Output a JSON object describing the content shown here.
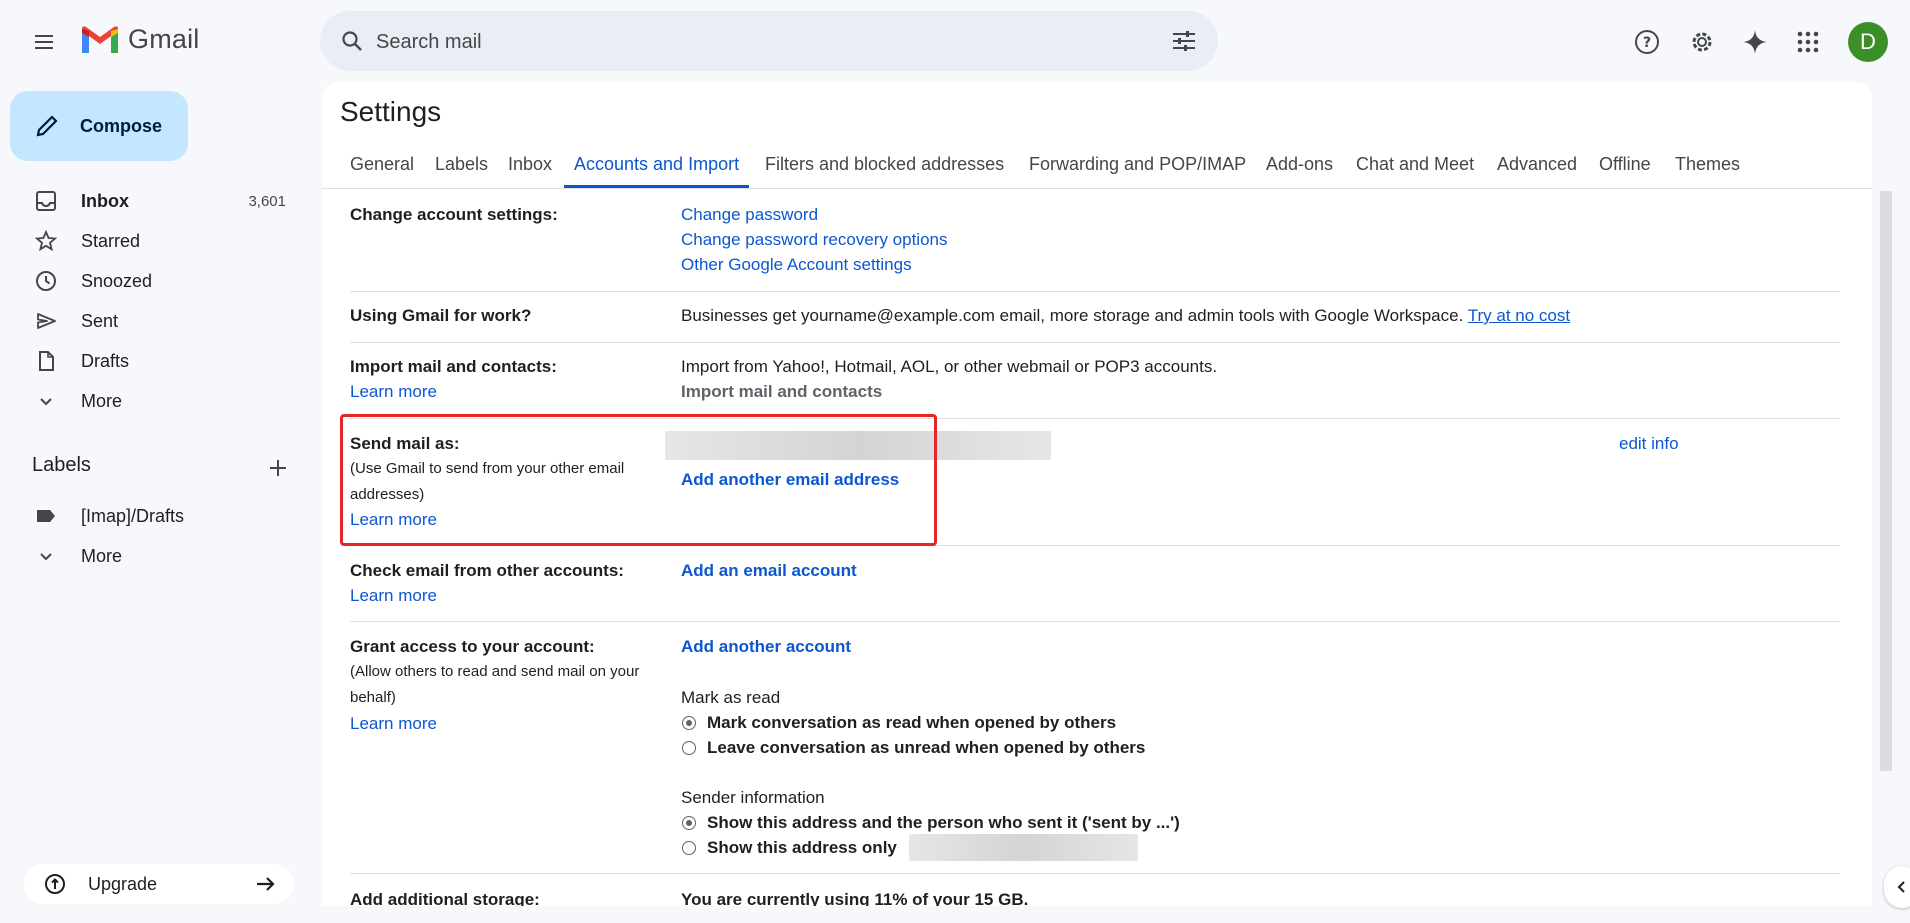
{
  "app": {
    "name": "Gmail",
    "colors": {
      "accent": "#0b57d0",
      "compose_bg": "#c2e7ff",
      "avatar_bg": "#3c8e28",
      "highlight": "#e32626"
    }
  },
  "search": {
    "placeholder": "Search mail"
  },
  "header": {
    "avatar_letter": "D",
    "icons": [
      "help-icon",
      "gear-icon",
      "gemini-sparkle-icon",
      "apps-grid-icon"
    ]
  },
  "sidebar": {
    "compose_label": "Compose",
    "items": [
      {
        "label": "Inbox",
        "count": "3,601",
        "icon": "inbox-icon"
      },
      {
        "label": "Starred",
        "icon": "star-icon"
      },
      {
        "label": "Snoozed",
        "icon": "clock-icon"
      },
      {
        "label": "Sent",
        "icon": "send-icon"
      },
      {
        "label": "Drafts",
        "icon": "draft-icon"
      },
      {
        "label": "More",
        "icon": "chevron-down-icon"
      }
    ],
    "labels_heading": "Labels",
    "labels": [
      {
        "label": "[Imap]/Drafts",
        "icon": "label-icon"
      },
      {
        "label": "More",
        "icon": "chevron-down-icon"
      }
    ],
    "upgrade_label": "Upgrade"
  },
  "settings": {
    "title": "Settings",
    "tabs": [
      "General",
      "Labels",
      "Inbox",
      "Accounts and Import",
      "Filters and blocked addresses",
      "Forwarding and POP/IMAP",
      "Add-ons",
      "Chat and Meet",
      "Advanced",
      "Offline",
      "Themes"
    ],
    "active_tab": "Accounts and Import",
    "change_account": {
      "label": "Change account settings:",
      "links": [
        "Change password",
        "Change password recovery options",
        "Other Google Account settings"
      ]
    },
    "work": {
      "label": "Using Gmail for work?",
      "text": "Businesses get yourname@example.com email, more storage and admin tools with Google Workspace.",
      "link": "Try at no cost"
    },
    "import": {
      "label": "Import mail and contacts:",
      "learn_more": "Learn more",
      "text": "Import from Yahoo!, Hotmail, AOL, or other webmail or POP3 accounts.",
      "action": "Import mail and contacts"
    },
    "send_as": {
      "label": "Send mail as:",
      "sub": "(Use Gmail to send from your other email addresses)",
      "learn_more": "Learn more",
      "add": "Add another email address",
      "edit": "edit info"
    },
    "check_email": {
      "label": "Check email from other accounts:",
      "learn_more": "Learn more",
      "add": "Add an email account"
    },
    "grant": {
      "label": "Grant access to your account:",
      "sub": "(Allow others to read and send mail on your behalf)",
      "learn_more": "Learn more",
      "add": "Add another account",
      "mark_heading": "Mark as read",
      "mark_opt1": "Mark conversation as read when opened by others",
      "mark_opt2": "Leave conversation as unread when opened by others",
      "sender_heading": "Sender information",
      "sender_opt1": "Show this address and the person who sent it ('sent by ...')",
      "sender_opt2": "Show this address only"
    },
    "storage": {
      "label": "Add additional storage:",
      "text": "You are currently using 11% of your 15 GB."
    }
  }
}
